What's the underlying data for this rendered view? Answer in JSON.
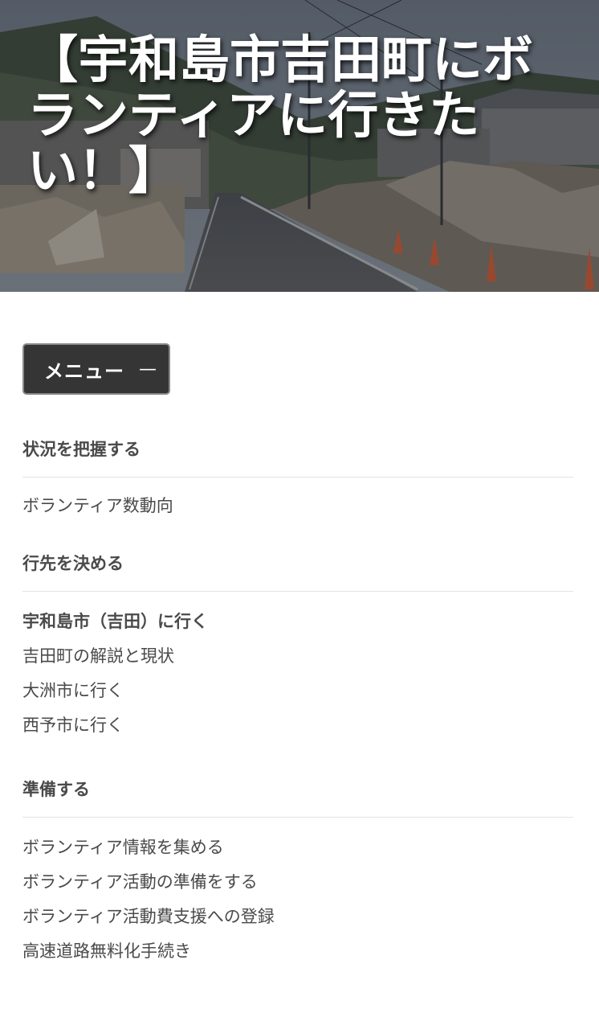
{
  "hero": {
    "title": "【宇和島市吉田町にボランティアに行きたい！】"
  },
  "menu": {
    "label": "メニュー",
    "toggle": "—"
  },
  "sections": [
    {
      "heading": "状況を把握する",
      "items": [
        "ボランティア数動向"
      ]
    },
    {
      "heading": "行先を決める",
      "items": [
        "宇和島市（吉田）に行く",
        "吉田町の解説と現状",
        "大洲市に行く",
        "西予市に行く"
      ]
    },
    {
      "heading": "準備する",
      "items": [
        "ボランティア情報を集める",
        "ボランティア活動の準備をする",
        "ボランティア活動費支援への登録",
        "高速道路無料化手続き"
      ]
    }
  ],
  "colors": {
    "menu_bg": "#353535",
    "text": "#4a4a4a",
    "divider": "#e3e3e3"
  }
}
